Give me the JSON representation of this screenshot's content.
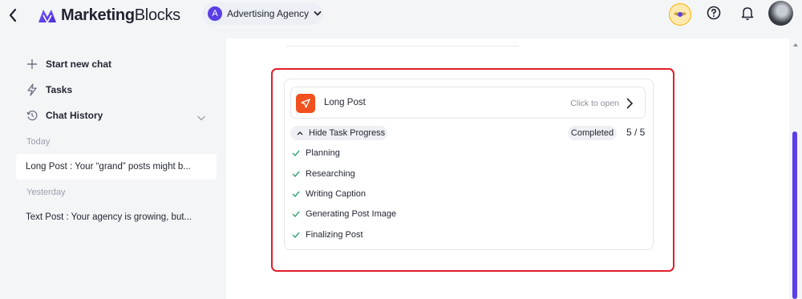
{
  "app": {
    "logo_text_bold": "Marketing",
    "logo_text_rest": "Blocks",
    "agency_initial": "A",
    "agency_name": "Advertising Agency"
  },
  "sidebar": {
    "start_new_chat": "Start new chat",
    "tasks": "Tasks",
    "chat_history": "Chat History",
    "today_label": "Today",
    "yesterday_label": "Yesterday",
    "history_today": [
      "Long Post : Your “grand” posts might b..."
    ],
    "history_yesterday": [
      "Text Post : Your agency is growing, but..."
    ]
  },
  "task_card": {
    "post_title": "Long Post",
    "click_to_open": "Click to open",
    "hide_progress": "Hide Task Progress",
    "status": "Completed",
    "count": "5 / 5",
    "steps": [
      "Planning",
      "Researching",
      "Writing Caption",
      "Generating Post Image",
      "Finalizing Post"
    ]
  },
  "colors": {
    "accent": "#5b3ee6",
    "post_icon": "#f0511f",
    "check": "#2fa66a",
    "highlight_frame": "#e01e2a"
  },
  "icons": {
    "back": "chevron-left-icon",
    "logo": "marketingblocks-logo-icon",
    "agency_dropdown": "chevron-down-icon",
    "badge": "award-badge-icon",
    "help": "help-circle-icon",
    "notifications": "bell-icon",
    "new_chat": "plus-icon",
    "tasks": "bolt-icon",
    "history": "history-icon",
    "post": "send-icon",
    "step_done": "check-icon"
  }
}
